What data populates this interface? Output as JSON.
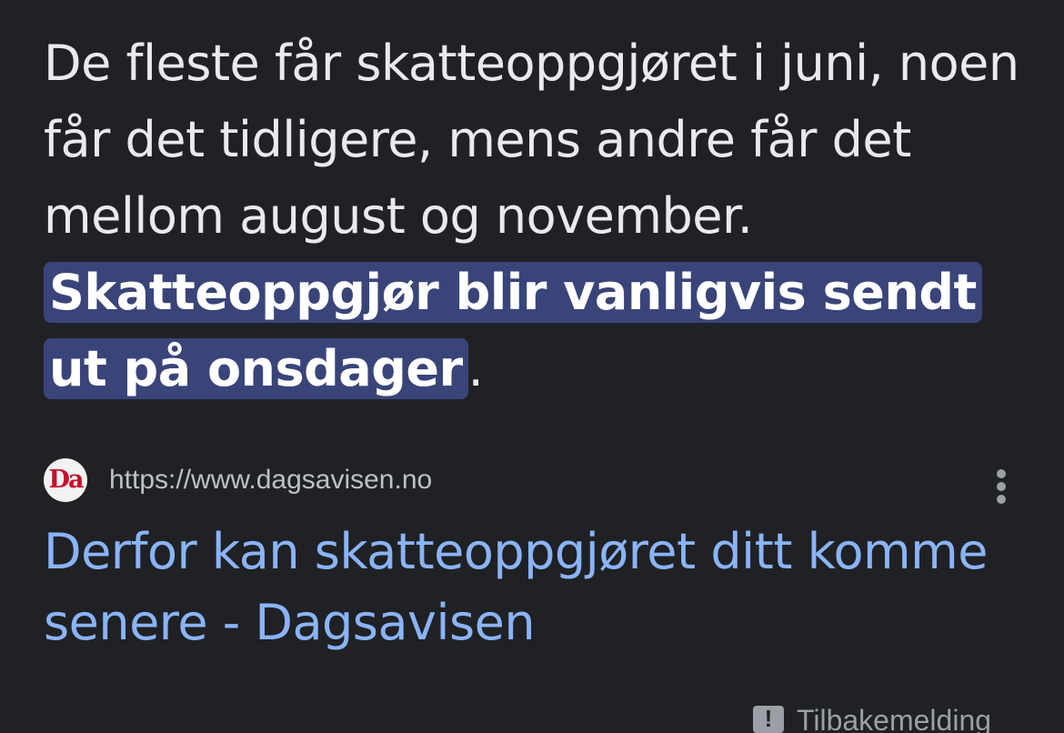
{
  "snippet": {
    "text_before": "De fleste får skatteoppgjøret i juni, noen får det tidligere, mens andre får det mellom august og november. ",
    "highlight": "Skatteoppgjør blir vanligvis sendt ut på onsdager",
    "text_after": "."
  },
  "source": {
    "favicon_text": "Da",
    "url": "https://www.dagsavisen.no",
    "more_icon": "more-vert-icon"
  },
  "result": {
    "title": "Derfor kan skatteoppgjøret ditt komme senere - Dagsavisen"
  },
  "feedback": {
    "icon": "feedback-icon",
    "label": "Tilbakemelding"
  },
  "colors": {
    "background": "#202124",
    "text": "#e8eaed",
    "highlight_bg": "#394479",
    "link": "#8ab4f8",
    "muted": "#9aa0a6",
    "favicon_red": "#c8102e"
  }
}
